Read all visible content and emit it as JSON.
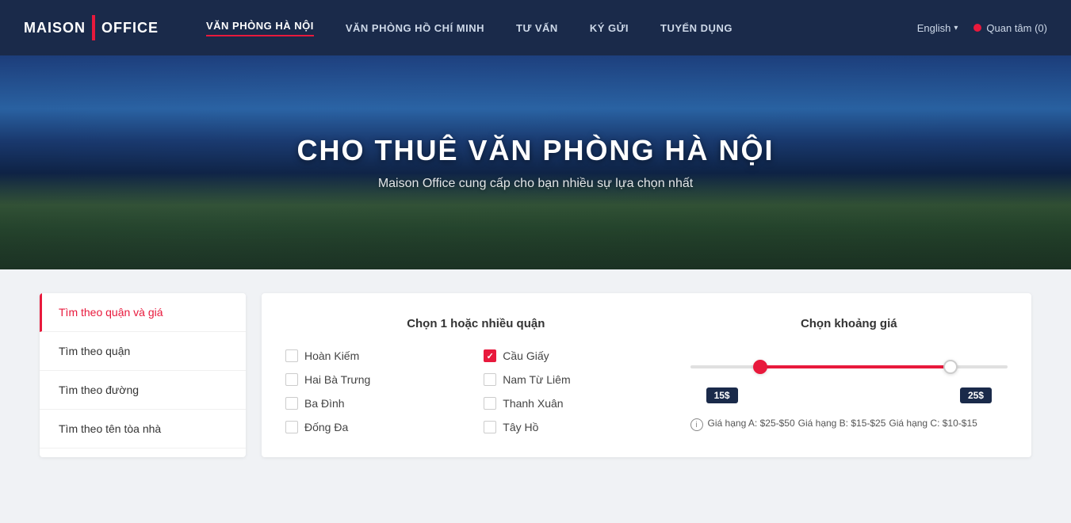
{
  "brand": {
    "maison": "MAISON",
    "office": "OFFICE"
  },
  "navbar": {
    "links": [
      {
        "id": "ha-noi",
        "label": "VĂN PHÒNG HÀ NỘI",
        "active": true
      },
      {
        "id": "ho-chi-minh",
        "label": "VĂN PHÒNG HỒ CHÍ MINH",
        "active": false
      },
      {
        "id": "tu-van",
        "label": "TƯ VẤN",
        "active": false
      },
      {
        "id": "ky-gui",
        "label": "KÝ GỬI",
        "active": false
      },
      {
        "id": "tuyen-dung",
        "label": "TUYỂN DỤNG",
        "active": false
      }
    ],
    "language": "English",
    "language_arrow": "▾",
    "quan_tam": "Quan tâm (0)"
  },
  "hero": {
    "title": "CHO THUÊ VĂN PHÒNG HÀ NỘI",
    "subtitle": "Maison Office cung cấp cho bạn nhiều sự lựa chọn nhất"
  },
  "sidebar": {
    "items": [
      {
        "id": "quan-gia",
        "label": "Tìm theo quận và giá",
        "active": true
      },
      {
        "id": "quan",
        "label": "Tìm theo quận",
        "active": false
      },
      {
        "id": "duong",
        "label": "Tìm theo đường",
        "active": false
      },
      {
        "id": "toa-nha",
        "label": "Tìm theo tên tòa nhà",
        "active": false
      }
    ]
  },
  "filter": {
    "district_title": "Chọn 1 hoặc nhiều quận",
    "districts": [
      {
        "id": "hoan-kiem",
        "label": "Hoàn Kiếm",
        "checked": false
      },
      {
        "id": "cau-giay",
        "label": "Cầu Giấy",
        "checked": true
      },
      {
        "id": "hai-ba-trung",
        "label": "Hai Bà Trưng",
        "checked": false
      },
      {
        "id": "nam-tu-liem",
        "label": "Nam Từ Liêm",
        "checked": false
      },
      {
        "id": "ba-dinh",
        "label": "Ba Đình",
        "checked": false
      },
      {
        "id": "thanh-xuan",
        "label": "Thanh Xuân",
        "checked": false
      },
      {
        "id": "dong-da",
        "label": "Đống Đa",
        "checked": false
      },
      {
        "id": "tay-ho",
        "label": "Tây Hồ",
        "checked": false
      }
    ],
    "price_title": "Chọn khoảng giá",
    "price_min": "15$",
    "price_max": "25$",
    "price_info_icon": "i",
    "price_ranges": [
      {
        "label": "Giá hạng A: $25-$50"
      },
      {
        "label": "Giá hạng B: $15-$25"
      },
      {
        "label": "Giá hạng C: $10-$15"
      }
    ]
  }
}
